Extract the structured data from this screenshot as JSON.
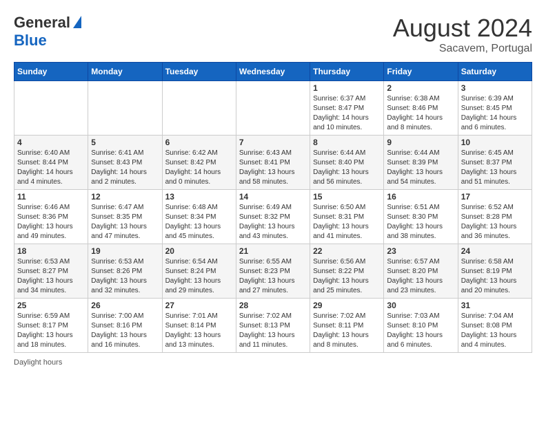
{
  "header": {
    "logo_general": "General",
    "logo_blue": "Blue",
    "month_year": "August 2024",
    "location": "Sacavem, Portugal"
  },
  "days_of_week": [
    "Sunday",
    "Monday",
    "Tuesday",
    "Wednesday",
    "Thursday",
    "Friday",
    "Saturday"
  ],
  "weeks": [
    [
      {
        "day": "",
        "info": ""
      },
      {
        "day": "",
        "info": ""
      },
      {
        "day": "",
        "info": ""
      },
      {
        "day": "",
        "info": ""
      },
      {
        "day": "1",
        "info": "Sunrise: 6:37 AM\nSunset: 8:47 PM\nDaylight: 14 hours\nand 10 minutes."
      },
      {
        "day": "2",
        "info": "Sunrise: 6:38 AM\nSunset: 8:46 PM\nDaylight: 14 hours\nand 8 minutes."
      },
      {
        "day": "3",
        "info": "Sunrise: 6:39 AM\nSunset: 8:45 PM\nDaylight: 14 hours\nand 6 minutes."
      }
    ],
    [
      {
        "day": "4",
        "info": "Sunrise: 6:40 AM\nSunset: 8:44 PM\nDaylight: 14 hours\nand 4 minutes."
      },
      {
        "day": "5",
        "info": "Sunrise: 6:41 AM\nSunset: 8:43 PM\nDaylight: 14 hours\nand 2 minutes."
      },
      {
        "day": "6",
        "info": "Sunrise: 6:42 AM\nSunset: 8:42 PM\nDaylight: 14 hours\nand 0 minutes."
      },
      {
        "day": "7",
        "info": "Sunrise: 6:43 AM\nSunset: 8:41 PM\nDaylight: 13 hours\nand 58 minutes."
      },
      {
        "day": "8",
        "info": "Sunrise: 6:44 AM\nSunset: 8:40 PM\nDaylight: 13 hours\nand 56 minutes."
      },
      {
        "day": "9",
        "info": "Sunrise: 6:44 AM\nSunset: 8:39 PM\nDaylight: 13 hours\nand 54 minutes."
      },
      {
        "day": "10",
        "info": "Sunrise: 6:45 AM\nSunset: 8:37 PM\nDaylight: 13 hours\nand 51 minutes."
      }
    ],
    [
      {
        "day": "11",
        "info": "Sunrise: 6:46 AM\nSunset: 8:36 PM\nDaylight: 13 hours\nand 49 minutes."
      },
      {
        "day": "12",
        "info": "Sunrise: 6:47 AM\nSunset: 8:35 PM\nDaylight: 13 hours\nand 47 minutes."
      },
      {
        "day": "13",
        "info": "Sunrise: 6:48 AM\nSunset: 8:34 PM\nDaylight: 13 hours\nand 45 minutes."
      },
      {
        "day": "14",
        "info": "Sunrise: 6:49 AM\nSunset: 8:32 PM\nDaylight: 13 hours\nand 43 minutes."
      },
      {
        "day": "15",
        "info": "Sunrise: 6:50 AM\nSunset: 8:31 PM\nDaylight: 13 hours\nand 41 minutes."
      },
      {
        "day": "16",
        "info": "Sunrise: 6:51 AM\nSunset: 8:30 PM\nDaylight: 13 hours\nand 38 minutes."
      },
      {
        "day": "17",
        "info": "Sunrise: 6:52 AM\nSunset: 8:28 PM\nDaylight: 13 hours\nand 36 minutes."
      }
    ],
    [
      {
        "day": "18",
        "info": "Sunrise: 6:53 AM\nSunset: 8:27 PM\nDaylight: 13 hours\nand 34 minutes."
      },
      {
        "day": "19",
        "info": "Sunrise: 6:53 AM\nSunset: 8:26 PM\nDaylight: 13 hours\nand 32 minutes."
      },
      {
        "day": "20",
        "info": "Sunrise: 6:54 AM\nSunset: 8:24 PM\nDaylight: 13 hours\nand 29 minutes."
      },
      {
        "day": "21",
        "info": "Sunrise: 6:55 AM\nSunset: 8:23 PM\nDaylight: 13 hours\nand 27 minutes."
      },
      {
        "day": "22",
        "info": "Sunrise: 6:56 AM\nSunset: 8:22 PM\nDaylight: 13 hours\nand 25 minutes."
      },
      {
        "day": "23",
        "info": "Sunrise: 6:57 AM\nSunset: 8:20 PM\nDaylight: 13 hours\nand 23 minutes."
      },
      {
        "day": "24",
        "info": "Sunrise: 6:58 AM\nSunset: 8:19 PM\nDaylight: 13 hours\nand 20 minutes."
      }
    ],
    [
      {
        "day": "25",
        "info": "Sunrise: 6:59 AM\nSunset: 8:17 PM\nDaylight: 13 hours\nand 18 minutes."
      },
      {
        "day": "26",
        "info": "Sunrise: 7:00 AM\nSunset: 8:16 PM\nDaylight: 13 hours\nand 16 minutes."
      },
      {
        "day": "27",
        "info": "Sunrise: 7:01 AM\nSunset: 8:14 PM\nDaylight: 13 hours\nand 13 minutes."
      },
      {
        "day": "28",
        "info": "Sunrise: 7:02 AM\nSunset: 8:13 PM\nDaylight: 13 hours\nand 11 minutes."
      },
      {
        "day": "29",
        "info": "Sunrise: 7:02 AM\nSunset: 8:11 PM\nDaylight: 13 hours\nand 8 minutes."
      },
      {
        "day": "30",
        "info": "Sunrise: 7:03 AM\nSunset: 8:10 PM\nDaylight: 13 hours\nand 6 minutes."
      },
      {
        "day": "31",
        "info": "Sunrise: 7:04 AM\nSunset: 8:08 PM\nDaylight: 13 hours\nand 4 minutes."
      }
    ]
  ],
  "footer": {
    "daylight_label": "Daylight hours"
  }
}
